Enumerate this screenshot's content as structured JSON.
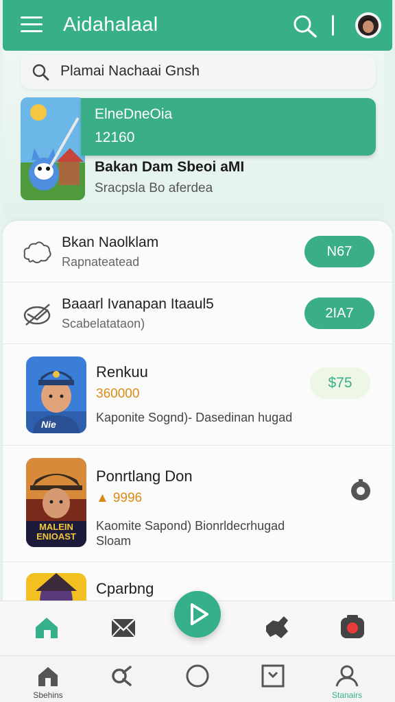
{
  "header": {
    "title": "Aidahalaal"
  },
  "search": {
    "placeholder": "Plamai Nachaai Gnsh"
  },
  "featured": {
    "title": "ElneDneOia",
    "count": "12160",
    "name": "Bakan Dam Sbeoi aMI",
    "subtitle": "Sracpsla Bo aferdea"
  },
  "rows": [
    {
      "title": "Bkan Naolklam",
      "subtitle": "Rapnateatead",
      "action": "N67",
      "icon": "cloud-icon"
    },
    {
      "title": "Baaarl Ivanapan Itaaul5",
      "subtitle": "Scabelatataon)",
      "action": "2IA7",
      "icon": "no-signal-icon"
    }
  ],
  "games": [
    {
      "title": "Renkuu",
      "value": "360000",
      "description": "Kaponite Sognd)- Dasedinan hugad",
      "price": "$75"
    },
    {
      "title": "Ponrtlang Don",
      "value": "9996",
      "description": "Kaomite Sapond) Bionrldecrhugad Sloam",
      "badge_text": "MALEIN ENIOAST"
    },
    {
      "title": "Cparbng"
    }
  ],
  "bottom_nav": [
    {
      "label": "Sbehins"
    },
    {
      "label": ""
    },
    {
      "label": ""
    },
    {
      "label": ""
    },
    {
      "label": "Stanairs"
    }
  ],
  "colors": {
    "brand_green": "#37b089",
    "price_text": "#3aae86",
    "value_orange": "#d98a14"
  }
}
